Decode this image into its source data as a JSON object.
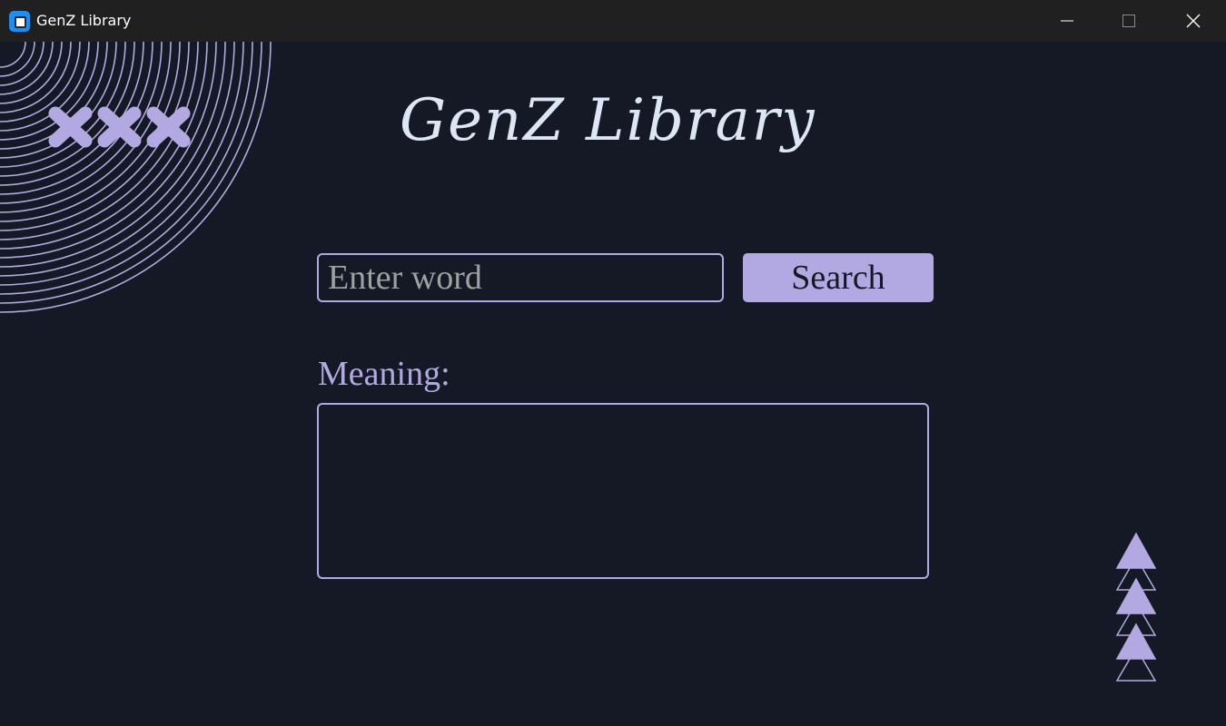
{
  "window": {
    "title": "GenZ Library",
    "icon": "app-icon"
  },
  "titlebar_buttons": {
    "minimize": "minimize-icon",
    "maximize": "maximize-icon",
    "close": "close-icon"
  },
  "header": {
    "title": "GenZ Library"
  },
  "search": {
    "placeholder": "Enter word",
    "value": "",
    "button_label": "Search"
  },
  "meaning": {
    "label": "Meaning:",
    "value": ""
  },
  "colors": {
    "background": "#141925",
    "accent": "#b3a9e2",
    "title_text": "#dce6f5",
    "titlebar": "#202020"
  },
  "decorations": {
    "top_left": "concentric-arcs",
    "x_marks": "x-marks-icon",
    "bottom_right": "stacked-triangles-icon"
  }
}
